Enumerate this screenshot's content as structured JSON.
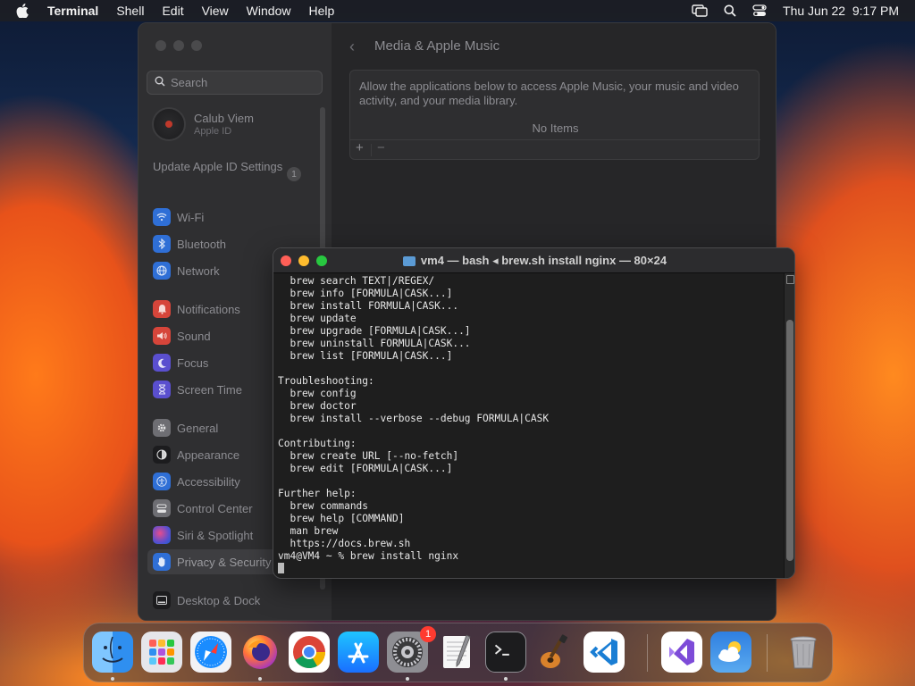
{
  "menubar": {
    "app": "Terminal",
    "items": [
      "Shell",
      "Edit",
      "View",
      "Window",
      "Help"
    ],
    "datetime": "Thu Jun 22  9:17 PM"
  },
  "settings": {
    "search_placeholder": "Search",
    "account_name": "Calub Viem",
    "account_sub": "Apple ID",
    "update_label": "Update Apple ID Settings",
    "update_badge": "1",
    "sidebar": [
      {
        "label": "Wi-Fi",
        "icon": "wifi-icon",
        "color": "#2f6fd6"
      },
      {
        "label": "Bluetooth",
        "icon": "bluetooth-icon",
        "color": "#2f6fd6"
      },
      {
        "label": "Network",
        "icon": "globe-icon",
        "color": "#2f6fd6"
      },
      {
        "label": "Notifications",
        "icon": "bell-icon",
        "color": "#d6453a"
      },
      {
        "label": "Sound",
        "icon": "speaker-icon",
        "color": "#d6453a"
      },
      {
        "label": "Focus",
        "icon": "moon-icon",
        "color": "#5a4fcf"
      },
      {
        "label": "Screen Time",
        "icon": "hourglass-icon",
        "color": "#5a4fcf"
      },
      {
        "label": "General",
        "icon": "gear-icon",
        "color": "#6e6e73"
      },
      {
        "label": "Appearance",
        "icon": "appearance-icon",
        "color": "#1c1c1e"
      },
      {
        "label": "Accessibility",
        "icon": "accessibility-icon",
        "color": "#2f6fd6"
      },
      {
        "label": "Control Center",
        "icon": "control-center-icon",
        "color": "#6e6e73"
      },
      {
        "label": "Siri & Spotlight",
        "icon": "siri-icon",
        "color": "#8a3fd0"
      },
      {
        "label": "Privacy & Security",
        "icon": "hand-icon",
        "color": "#2f6fd6"
      },
      {
        "label": "Desktop & Dock",
        "icon": "dock-icon",
        "color": "#1c1c1e"
      }
    ],
    "content_title": "Media & Apple Music",
    "access_desc": "Allow the applications below to access Apple Music, your music and video activity, and your media library.",
    "empty_label": "No Items",
    "add_label": "+",
    "remove_label": "−"
  },
  "terminal": {
    "title": "vm4 — bash ◂ brew.sh install nginx — 80×24",
    "lines": [
      "  brew search TEXT|/REGEX/",
      "  brew info [FORMULA|CASK...]",
      "  brew install FORMULA|CASK...",
      "  brew update",
      "  brew upgrade [FORMULA|CASK...]",
      "  brew uninstall FORMULA|CASK...",
      "  brew list [FORMULA|CASK...]",
      "",
      "Troubleshooting:",
      "  brew config",
      "  brew doctor",
      "  brew install --verbose --debug FORMULA|CASK",
      "",
      "Contributing:",
      "  brew create URL [--no-fetch]",
      "  brew edit [FORMULA|CASK...]",
      "",
      "Further help:",
      "  brew commands",
      "  brew help [COMMAND]",
      "  man brew",
      "  https://docs.brew.sh",
      "vm4@VM4 ~ % brew install nginx"
    ]
  },
  "dock": {
    "apps": [
      {
        "name": "finder",
        "color": "#2f8ff0"
      },
      {
        "name": "launchpad",
        "color": "#d9d9de"
      },
      {
        "name": "safari",
        "color": "#f2f2f5"
      },
      {
        "name": "firefox",
        "color": "#7b2fd0"
      },
      {
        "name": "chrome",
        "color": "#ffffff"
      },
      {
        "name": "app-store",
        "color": "#1a8cff"
      },
      {
        "name": "system-settings",
        "color": "#8e8e93"
      },
      {
        "name": "textedit",
        "color": "#f5f5f5"
      },
      {
        "name": "terminal",
        "color": "#1c1c1e"
      },
      {
        "name": "garageband",
        "color": "#2a2a2a"
      },
      {
        "name": "vscode",
        "color": "#ffffff"
      },
      {
        "name": "visual-studio",
        "color": "#ffffff"
      },
      {
        "name": "weather",
        "color": "#3a8ee6"
      },
      {
        "name": "trash",
        "color": "#6e6e73"
      }
    ],
    "settings_badge": "1"
  }
}
